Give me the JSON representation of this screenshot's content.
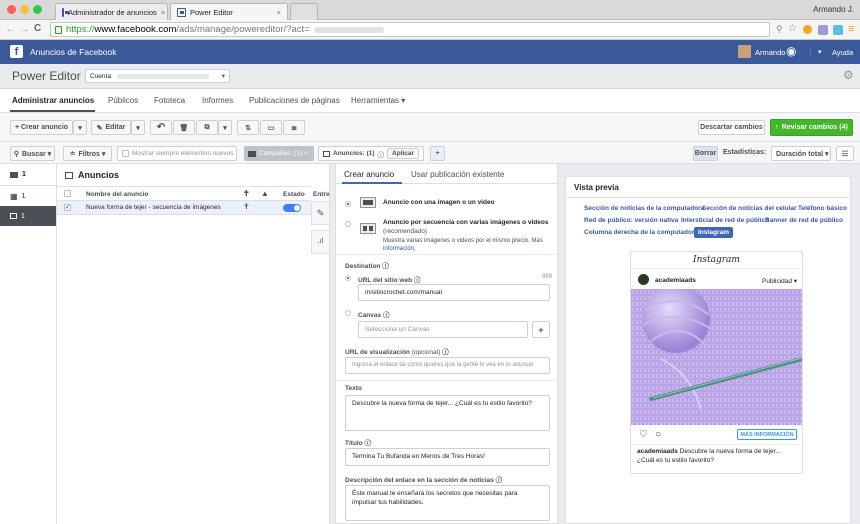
{
  "browser": {
    "tabs": [
      {
        "label": "Administrador de anuncios"
      },
      {
        "label": "Power Editor"
      }
    ],
    "user": "Armando J.",
    "url_prefix": "https://",
    "url_host": "www.facebook.com",
    "url_path": "/ads/manage/powereditor/?act="
  },
  "fbbar": {
    "title": "Anuncios de Facebook",
    "user": "Armando",
    "help": "Ayuda"
  },
  "pe": {
    "title": "Power Editor",
    "account_label": "Cuenta:"
  },
  "nav": {
    "tabs": [
      "Administrar anuncios",
      "Públicos",
      "Fototeca",
      "Informes",
      "Publicaciones de páginas",
      "Herramientas ▾"
    ]
  },
  "toolbar": {
    "create": "+ Crear anuncio",
    "edit": "Editar",
    "discard": "Descartar cambios",
    "review": "Revisar cambios (4)"
  },
  "filterbar": {
    "search": "Buscar ▾",
    "filters": "Filtros ▾",
    "always_show": "Mostrar siempre elementos nuevos",
    "campaigns": "Campañas: (1) ×",
    "ads": "Anuncios: (1)",
    "apply": "Aplicar",
    "clear": "Borrar",
    "stats_label": "Estadísticas:",
    "stats_value": "Duración total ▾"
  },
  "leftnav": {
    "campaign_count": "1",
    "adset_count": "1",
    "ad_count": "1"
  },
  "table": {
    "title": "Anuncios",
    "col_name": "Nombre del anuncio",
    "col_status": "Estado",
    "col_delivery": "Entreg",
    "row_name": "Nueva forma de tejer - secuencia de imágenes"
  },
  "editor": {
    "tab_create": "Crear anuncio",
    "tab_existing": "Usar publicación existente",
    "opt_single": "Anuncio con una imagen o un video",
    "opt_carousel": "Anuncio por secuencia con varias imágenes o videos",
    "opt_carousel_rec": "(recomendado)",
    "opt_carousel_desc": "Muestra varias imágenes o videos por el mismo precio.",
    "more_info": "Más información.",
    "destination": "Destination",
    "website_url": "URL del sitio web",
    "url_count": "999",
    "url_value": "misitiocrochet.com/manual",
    "canvas": "Canvas",
    "canvas_ph": "Selecciona un Canvas",
    "display_url": "URL de visualización",
    "optional": "(opcional)",
    "display_url_ph": "Ingresa el enlace tal como quieres que la gente lo vea en tu anuncio",
    "text_label": "Texto",
    "text_value": "Descubre la nueva forma de tejer... ¿Cuál es tu estilo favorito?",
    "headline_label": "Título",
    "headline_value": "Termina Tu Bufanda en Menos de Tres Horas!",
    "desc_label": "Descripción del enlace en la sección de noticias",
    "desc_value": "Éste manual te enseñará los secretos que necesitas para impulsar tus habilidades."
  },
  "preview": {
    "title": "Vista previa",
    "placements": [
      "Sección de noticias de la computadora",
      "Sección de noticias del celular",
      "Teléfono básico",
      "Red de público: versión nativa",
      "Intersticial de red de público",
      "Banner de red de público",
      "Columna derecha de la computadora",
      "Instagram"
    ],
    "ig_logo": "Instagram",
    "account": "academiaads",
    "sponsored": "Publicidad ▾",
    "cta": "MÁS INFORMACIÓN",
    "caption_user": "academiaads",
    "caption": "Descubre la nueva forma de tejer... ¿Cuál es tu estilo favorito?"
  },
  "colors": {
    "fb_blue": "#3b5998",
    "green": "#42b72a",
    "toggle": "#4080ff"
  }
}
